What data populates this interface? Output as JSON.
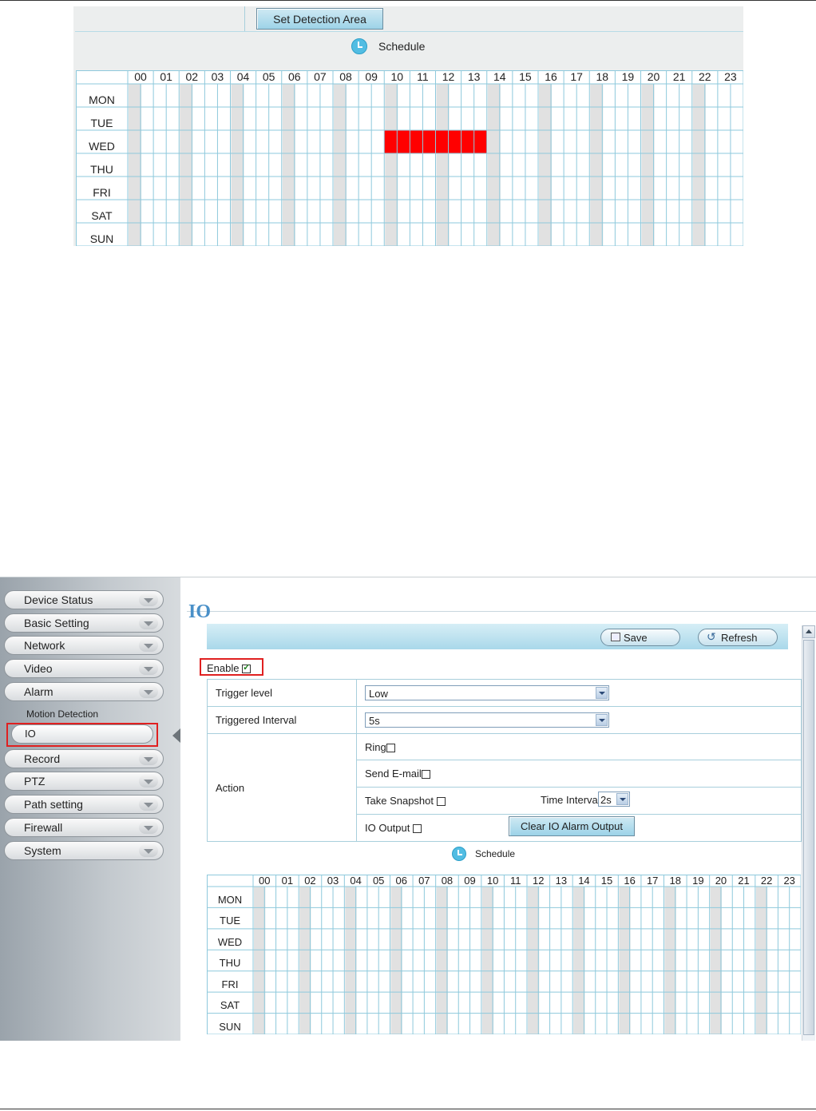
{
  "top_panel": {
    "detect_button": "Set Detection Area",
    "schedule_label": "Schedule",
    "hours": [
      "00",
      "01",
      "02",
      "03",
      "04",
      "05",
      "06",
      "07",
      "08",
      "09",
      "10",
      "11",
      "12",
      "13",
      "14",
      "15",
      "16",
      "17",
      "18",
      "19",
      "20",
      "21",
      "22",
      "23"
    ],
    "days": [
      "MON",
      "TUE",
      "WED",
      "THU",
      "FRI",
      "SAT",
      "SUN"
    ],
    "selected": [
      {
        "day": "WED",
        "from_hour": "10",
        "to_hour": "13"
      }
    ],
    "selected_color": "#ff0000"
  },
  "sidebar": {
    "items": [
      {
        "label": "Device Status"
      },
      {
        "label": "Basic Setting"
      },
      {
        "label": "Network"
      },
      {
        "label": "Video"
      },
      {
        "label": "Alarm"
      },
      {
        "label": "Record"
      },
      {
        "label": "PTZ"
      },
      {
        "label": "Path setting"
      },
      {
        "label": "Firewall"
      },
      {
        "label": "System"
      }
    ],
    "sub_items": [
      {
        "label": "Motion Detection"
      },
      {
        "label": "IO",
        "selected": true
      }
    ]
  },
  "io": {
    "title": "IO",
    "save_label": "Save",
    "refresh_label": "Refresh",
    "enable_label": "Enable",
    "enable_checked": true,
    "trigger_level_label": "Trigger level",
    "trigger_level_value": "Low",
    "triggered_interval_label": "Triggered Interval",
    "triggered_interval_value": "5s",
    "action_label": "Action",
    "ring_label": "Ring",
    "send_email_label": "Send E-mail",
    "take_snapshot_label": "Take Snapshot",
    "time_interval_label": "Time Interval",
    "time_interval_value": "2s",
    "io_output_label": "IO Output",
    "clear_button": "Clear IO Alarm Output",
    "schedule_label": "Schedule",
    "accent_color": "#4a90c8",
    "highlight_color": "#e02020"
  }
}
